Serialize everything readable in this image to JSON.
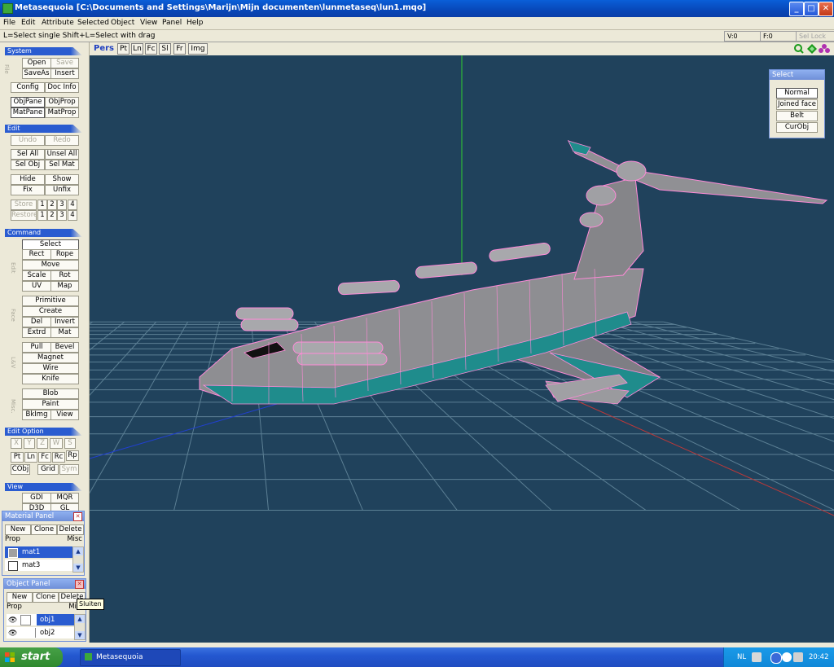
{
  "window": {
    "title": "Metasequoia [C:\\Documents and Settings\\Marijn\\Mijn documenten\\lunmetaseq\\lun1.mqo]",
    "minimize": "_",
    "maximize": "□",
    "close": "✕"
  },
  "menubar": [
    "File",
    "Edit",
    "Attribute",
    "Selected",
    "Object",
    "View",
    "Panel",
    "Help"
  ],
  "status": {
    "hint": "L=Select single  Shift+L=Select with drag",
    "vertices": "V:0",
    "faces": "F:0",
    "sel_lock": "Sel Lock"
  },
  "view_tabs": {
    "mode": "Pers",
    "items": [
      "Pt",
      "Ln",
      "Fc",
      "Sl",
      "Fr",
      "Img"
    ]
  },
  "system": {
    "header": "System",
    "side_label": "File",
    "rows": [
      [
        "Open",
        "Save"
      ],
      [
        "SaveAs",
        "Insert"
      ],
      [
        "Config",
        "Doc Info"
      ],
      [
        "ObjPane",
        "ObjProp"
      ],
      [
        "MatPane",
        "MatProp"
      ]
    ]
  },
  "edit": {
    "header": "Edit",
    "rows": [
      [
        "Undo",
        "Redo"
      ],
      [
        "Sel All",
        "Unsel All"
      ],
      [
        "Sel Obj",
        "Sel Mat"
      ],
      [
        "Hide",
        "Show"
      ],
      [
        "Fix",
        "Unfix"
      ]
    ],
    "store": "Store",
    "restore": "Restore",
    "nums": [
      "1",
      "2",
      "3",
      "4"
    ]
  },
  "command": {
    "header": "Command",
    "side_labels": [
      "Edit",
      "Face",
      "L&V",
      "Misc."
    ],
    "select": "Select",
    "rows": [
      [
        "Rect",
        "Rope"
      ],
      [
        "Move"
      ],
      [
        "Scale",
        "Rot"
      ],
      [
        "UV",
        "Map"
      ],
      [
        "Primitive"
      ],
      [
        "Create"
      ],
      [
        "Del",
        "Invert"
      ],
      [
        "Extrd",
        "Mat"
      ],
      [
        "Pull",
        "Bevel"
      ],
      [
        "Magnet"
      ],
      [
        "Wire"
      ],
      [
        "Knife"
      ],
      [
        "Blob"
      ],
      [
        "Paint"
      ],
      [
        "BkImg",
        "View"
      ]
    ]
  },
  "edit_option": {
    "header": "Edit Option",
    "axes": [
      "X",
      "Y",
      "Z",
      "W",
      "S"
    ],
    "modes": [
      "Pt",
      "Ln",
      "Fc",
      "Rc",
      "Rp"
    ],
    "row3": [
      "CObj",
      "Grid",
      "Sym"
    ]
  },
  "view_section": {
    "header": "View",
    "row1": [
      "GDI",
      "MQR"
    ],
    "row2": [
      "D3D",
      "GL"
    ]
  },
  "material_panel": {
    "title": "Material Panel",
    "buttons": [
      "New",
      "Clone",
      "Delete"
    ],
    "buttons2": [
      "Prop",
      "Misc"
    ],
    "items": [
      "mat1",
      "mat3"
    ]
  },
  "object_panel": {
    "title": "Object Panel",
    "buttons": [
      "New",
      "Clone",
      "Delete"
    ],
    "buttons2": [
      "Prop",
      "Misc"
    ],
    "items": [
      "obj1",
      "obj2"
    ]
  },
  "tooltip": "Sluiten",
  "select_panel": {
    "title": "Select",
    "buttons": [
      "Normal",
      "Joined face",
      "Belt",
      "CurObj"
    ]
  },
  "taskbar": {
    "start": "start",
    "task": "Metasequoia",
    "lang": "NL",
    "clock": "20:42"
  },
  "colors": {
    "viewport_bg": "#20425c",
    "grid": "#5b7f94",
    "wire": "#ff8ad8",
    "body": "#8a8a8e",
    "teal": "#1f8c8c",
    "y_axis": "#2fd02f",
    "z_axis": "#2040d0",
    "x_axis": "#c03838"
  }
}
